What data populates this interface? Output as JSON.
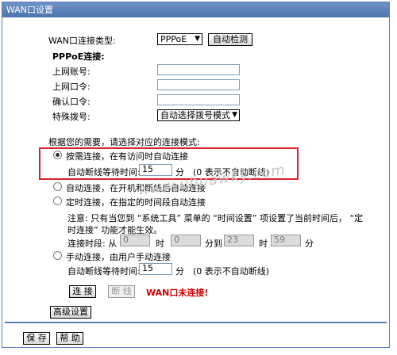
{
  "panel": {
    "title": "WAN口设置"
  },
  "wan_type": {
    "label": "WAN口连接类型:",
    "selected": "PPPoE",
    "detect_button": "自动检测"
  },
  "pppoe": {
    "heading": "PPPoE连接:",
    "account_label": "上网账号:",
    "password_label": "上网口令:",
    "confirm_label": "确认口令:",
    "dial_label": "特殊拨号:",
    "dial_selected": "自动选择拨号模式"
  },
  "mode_prompt": "根据您的需要，请选择对应的连接模式:",
  "modes": {
    "on_demand": {
      "label": "按需连接，在有访问时自动连接",
      "idle_label": "自动断线等待时间:",
      "idle_value": "15",
      "unit": "分",
      "hint": "(0 表示不自动断线)"
    },
    "auto": {
      "label": "自动连接，在开机和断线后自动连接"
    },
    "timed": {
      "label": "定时连接，在指定的时间段自动连接",
      "note_line1": "注意: 只有当您到 “系统工具” 菜单的 “时间设置” 项设置了当前时间后， “定",
      "note_line2": "时连接” 功能才能生效。",
      "period_label": "连接时段: 从",
      "from_hour": "0",
      "hour_unit": "时",
      "from_min": "0",
      "to_label": "分到",
      "to_hour": "23",
      "to_min": "59",
      "min_unit": "分"
    },
    "manual": {
      "label": "手动连接，由用户手动连接",
      "idle_label": "自动断线等待时间:",
      "idle_value": "15",
      "unit": "分",
      "hint": "(0 表示不自动断线)"
    }
  },
  "actions": {
    "connect": "连 接",
    "disconnect": "断 线",
    "status": "WAN口未连接!"
  },
  "advanced_button": "高级设置",
  "footer": {
    "save": "保 存",
    "help": "帮 助"
  },
  "watermark": "www.uhuawky.com",
  "colors": {
    "title_bar": "#5a7fb8",
    "highlight": "#d8232a",
    "status": "#d20000"
  }
}
